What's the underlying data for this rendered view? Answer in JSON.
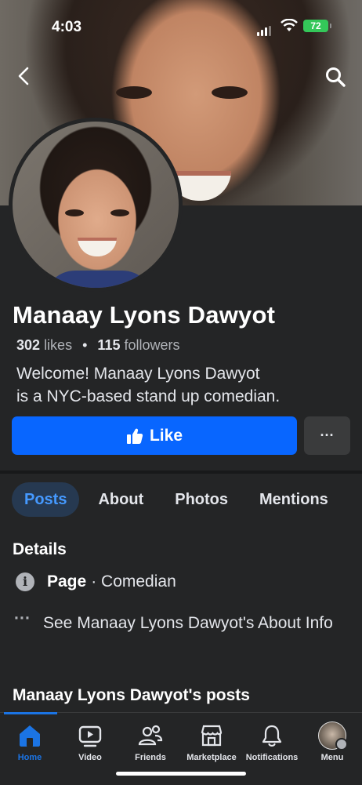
{
  "status_bar": {
    "time": "4:03",
    "battery": "72"
  },
  "profile": {
    "name": "Manaay Lyons Dawyot",
    "likes_count": "302",
    "likes_label": "likes",
    "separator": "•",
    "followers_count": "115",
    "followers_label": "followers",
    "bio_line1": "Welcome! Manaay Lyons Dawyot",
    "bio_line2": "is a NYC-based stand up comedian."
  },
  "actions": {
    "like_label": "Like",
    "more_label": "···"
  },
  "tabs": [
    {
      "label": "Posts",
      "active": true
    },
    {
      "label": "About"
    },
    {
      "label": "Photos"
    },
    {
      "label": "Mentions"
    }
  ],
  "details": {
    "title": "Details",
    "page_label": "Page",
    "page_category": "· Comedian",
    "about_link": "See Manaay Lyons Dawyot's About Info"
  },
  "posts_section": {
    "title": "Manaay Lyons Dawyot's posts"
  },
  "bottom_nav": [
    {
      "label": "Home",
      "icon": "home-icon",
      "active": true
    },
    {
      "label": "Video",
      "icon": "video-icon"
    },
    {
      "label": "Friends",
      "icon": "friends-icon"
    },
    {
      "label": "Marketplace",
      "icon": "marketplace-icon"
    },
    {
      "label": "Notifications",
      "icon": "bell-icon"
    },
    {
      "label": "Menu",
      "icon": "profile-menu-icon"
    }
  ],
  "colors": {
    "accent": "#0866ff",
    "background": "#242526",
    "active_tab_bg": "#263951"
  }
}
